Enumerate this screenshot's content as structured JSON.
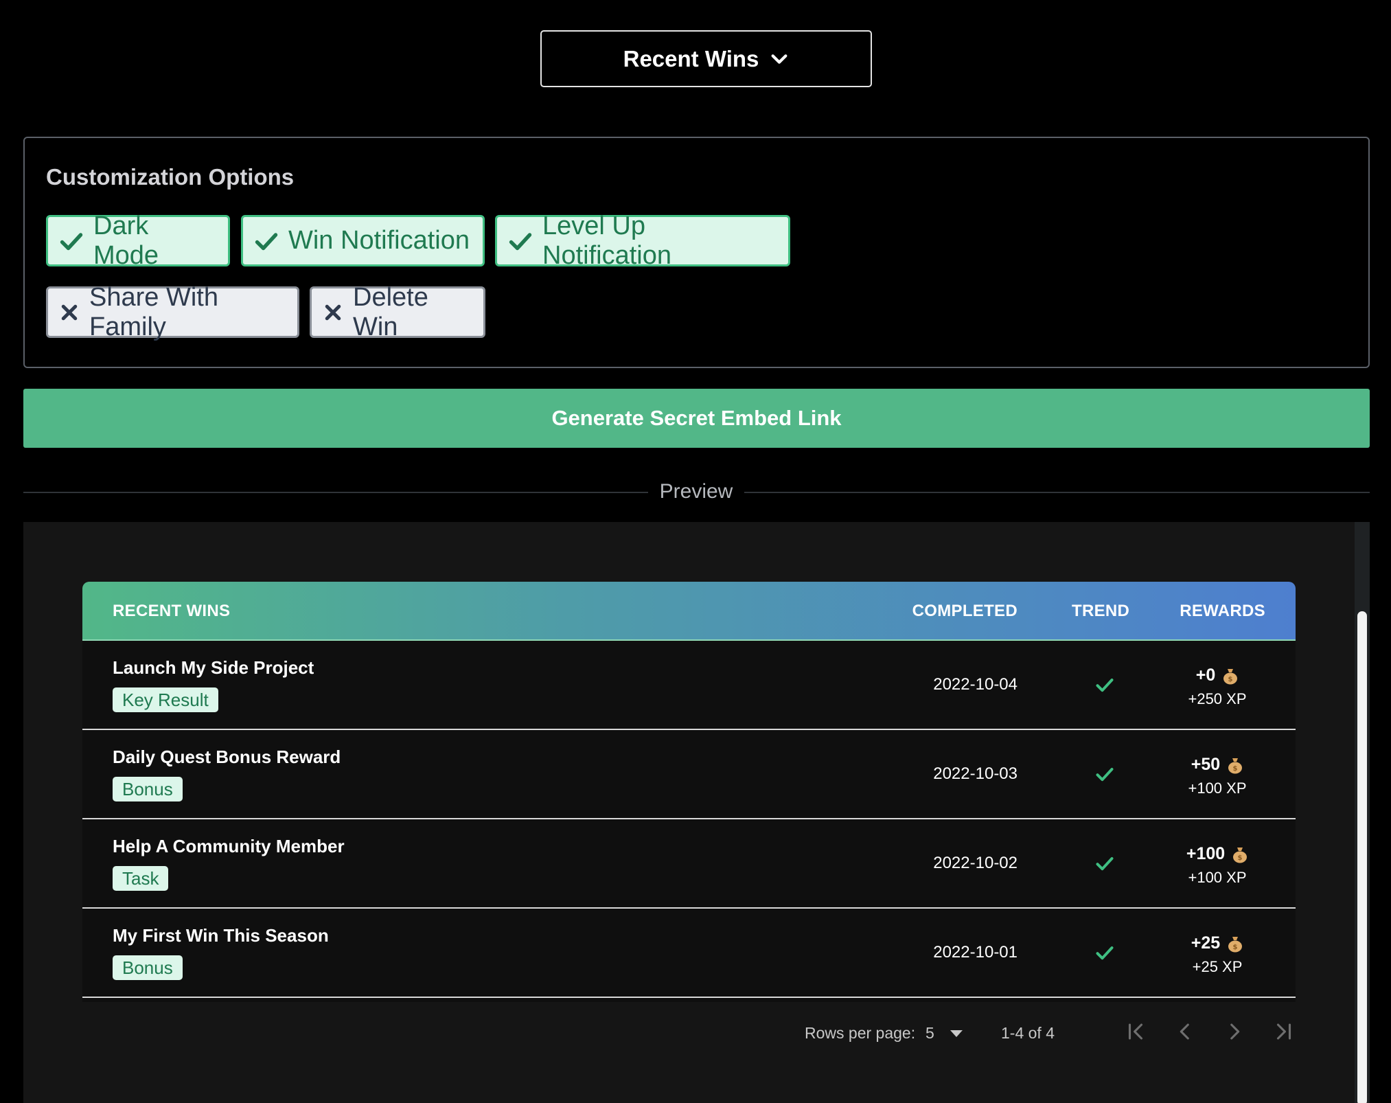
{
  "dropdown": {
    "label": "Recent Wins",
    "icon": "chevron-down-icon"
  },
  "customization": {
    "title": "Customization Options",
    "options": [
      {
        "label": "Dark Mode",
        "enabled": true
      },
      {
        "label": "Win Notification",
        "enabled": true
      },
      {
        "label": "Level Up Notification",
        "enabled": true
      },
      {
        "label": "Share With Family",
        "enabled": false
      },
      {
        "label": "Delete Win",
        "enabled": false
      }
    ]
  },
  "generate_button": {
    "label": "Generate Secret Embed Link"
  },
  "preview": {
    "label": "Preview",
    "table": {
      "headers": {
        "name": "RECENT WINS",
        "completed": "COMPLETED",
        "trend": "TREND",
        "rewards": "REWARDS"
      },
      "rows": [
        {
          "title": "Launch My Side Project",
          "tag": "Key Result",
          "completed": "2022-10-04",
          "trend": "check-icon",
          "coins": "+0",
          "xp": "+250 XP"
        },
        {
          "title": "Daily Quest Bonus Reward",
          "tag": "Bonus",
          "completed": "2022-10-03",
          "trend": "check-icon",
          "coins": "+50",
          "xp": "+100 XP"
        },
        {
          "title": "Help A Community Member",
          "tag": "Task",
          "completed": "2022-10-02",
          "trend": "check-icon",
          "coins": "+100",
          "xp": "+100 XP"
        },
        {
          "title": "My First Win This Season",
          "tag": "Bonus",
          "completed": "2022-10-01",
          "trend": "check-icon",
          "coins": "+25",
          "xp": "+25 XP"
        }
      ],
      "pagination": {
        "rows_per_page_label": "Rows per page:",
        "rows_per_page": "5",
        "range": "1-4 of 4"
      }
    }
  },
  "colors": {
    "accent_green": "#52b788",
    "header_gradient_end": "#4e7fcf",
    "chip_on_bg": "#dcf6ea",
    "chip_off_bg": "#eceef2"
  }
}
